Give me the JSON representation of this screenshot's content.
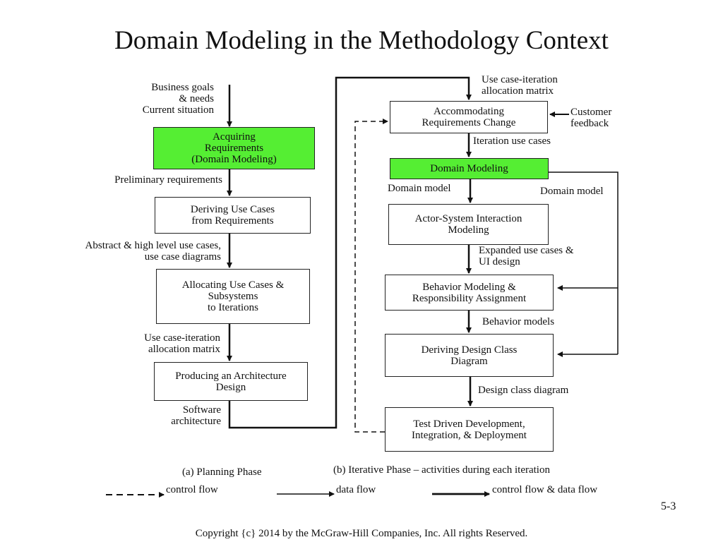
{
  "title": "Domain Modeling in the Methodology Context",
  "planning": {
    "input_label": "Business goals\n& needs\nCurrent situation",
    "boxes": [
      {
        "label": "Acquiring\nRequirements\n(Domain Modeling)",
        "highlight": true
      },
      {
        "label": "Deriving Use Cases\nfrom Requirements"
      },
      {
        "label": "Allocating Use Cases &\nSubsystems\nto Iterations"
      },
      {
        "label": "Producing an Architecture\nDesign"
      }
    ],
    "flows": [
      "Preliminary requirements",
      "Abstract & high level use cases,\nuse case diagrams",
      "Use case-iteration\nallocation matrix",
      "Software\narchitecture"
    ],
    "caption": "(a) Planning Phase"
  },
  "iterative": {
    "input_label": "Use case-iteration\nallocation matrix",
    "customer_feedback": "Customer\nfeedback",
    "boxes": [
      {
        "label": "Accommodating\nRequirements Change"
      },
      {
        "label": "Domain Modeling",
        "highlight": true
      },
      {
        "label": "Actor-System Interaction\nModeling"
      },
      {
        "label": "Behavior Modeling &\nResponsibility Assignment"
      },
      {
        "label": "Deriving Design Class\nDiagram"
      },
      {
        "label": "Test Driven Development,\nIntegration, & Deployment"
      }
    ],
    "flows": [
      "Iteration use cases",
      "Domain model",
      "Expanded use cases &\nUI design",
      "Behavior models",
      "Design class diagram"
    ],
    "side_flow": "Domain model",
    "caption": "(b) Iterative Phase – activities during each iteration"
  },
  "legend": {
    "control_flow": "control flow",
    "data_flow": "data flow",
    "both": "control flow & data flow"
  },
  "colors": {
    "highlight": "#55ee33"
  },
  "page_number": "5-3",
  "copyright": "Copyright {c} 2014 by the McGraw-Hill Companies, Inc. All rights Reserved."
}
